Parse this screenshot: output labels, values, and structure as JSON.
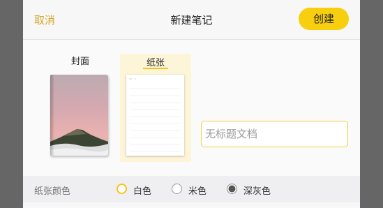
{
  "header": {
    "cancel_label": "取消",
    "title": "新建笔记",
    "create_label": "创建"
  },
  "tabs": {
    "cover_label": "封面",
    "paper_label": "纸张",
    "selected": "纸张"
  },
  "title_input": {
    "value": "",
    "placeholder": "无标题文档"
  },
  "paper_color": {
    "label": "纸张颜色",
    "options": [
      {
        "label": "白色",
        "selected": true,
        "ring_color": "#f5c518"
      },
      {
        "label": "米色",
        "selected": false,
        "ring_color": "#999999"
      },
      {
        "label": "深灰色",
        "selected": false,
        "ring_color": "#555555"
      }
    ]
  },
  "colors": {
    "accent": "#f8cf0e",
    "cancel_text": "#d4a72c",
    "overlay": "#666666"
  }
}
